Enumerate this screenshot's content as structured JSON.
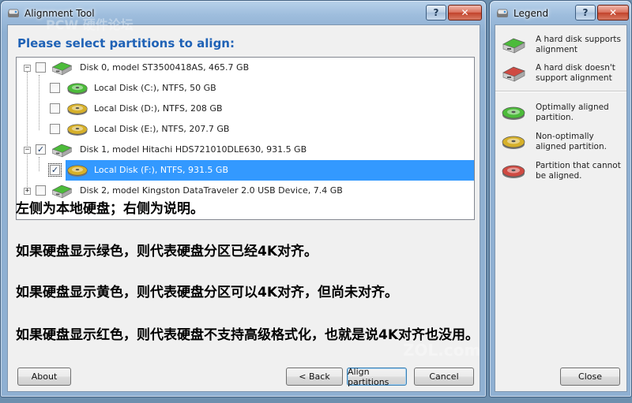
{
  "main": {
    "title": "Alignment Tool",
    "help_glyph": "?",
    "close_glyph": "✕",
    "prompt": "Please select partitions to align:",
    "tree": [
      {
        "expander": "−",
        "checked": false,
        "icon": "disk-green",
        "label": "Disk 0, model ST3500418AS, 465.7 GB"
      },
      {
        "checked": false,
        "icon": "partition-green",
        "label": "Local Disk (C:), NTFS, 50 GB"
      },
      {
        "checked": false,
        "icon": "partition-yellow",
        "label": "Local Disk (D:), NTFS, 208 GB"
      },
      {
        "checked": false,
        "icon": "partition-yellow",
        "label": "Local Disk (E:), NTFS, 207.7 GB"
      },
      {
        "expander": "−",
        "checked": true,
        "icon": "disk-green",
        "label": "Disk 1, model Hitachi HDS721010DLE630, 931.5 GB"
      },
      {
        "checked": true,
        "icon": "partition-yellow",
        "label": "Local Disk (F:), NTFS, 931.5 GB",
        "selected": true
      },
      {
        "expander": "+",
        "checked": false,
        "icon": "disk-green",
        "label": "Disk 2, model Kingston DataTraveler 2.0 USB Device, 7.4 GB"
      }
    ],
    "annotations": [
      "左侧为本地硬盘；右侧为说明。",
      "如果硬盘显示绿色，则代表硬盘分区已经4K对齐。",
      "如果硬盘显示黄色，则代表硬盘分区可以4K对齐，但尚未对齐。",
      "如果硬盘显示红色，则代表硬盘不支持高级格式化，也就是说4K对齐也没用。"
    ],
    "buttons": {
      "about": "About",
      "back": "< Back",
      "align": "Align partitions",
      "cancel": "Cancel"
    }
  },
  "legend": {
    "title": "Legend",
    "help_glyph": "?",
    "close_glyph": "✕",
    "disk_items": [
      {
        "icon": "disk-green",
        "text": "A hard disk supports alignment"
      },
      {
        "icon": "disk-red",
        "text": "A hard disk doesn't support alignment"
      }
    ],
    "partition_items": [
      {
        "icon": "partition-green",
        "text": "Optimally aligned partition."
      },
      {
        "icon": "partition-yellow",
        "text": "Non-optimally aligned partition."
      },
      {
        "icon": "partition-red",
        "text": "Partition that cannot be aligned."
      }
    ],
    "close_button": "Close"
  },
  "colors": {
    "green": "#4cbb3a",
    "yellow": "#d6b02a",
    "red": "#cf4a42",
    "selection": "#3399ff",
    "prompt": "#1f62b6"
  }
}
